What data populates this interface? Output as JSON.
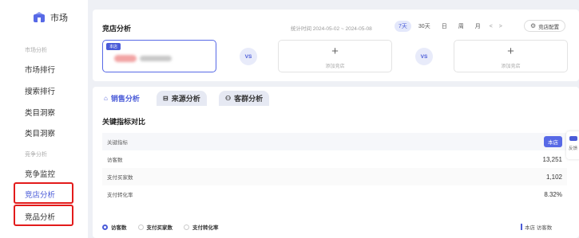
{
  "sidebar": {
    "brand": "市场",
    "sections": [
      {
        "label": "市场分析",
        "items": [
          "市场排行",
          "搜索排行",
          "类目洞察",
          "类目洞察"
        ]
      },
      {
        "label": "竞争分析",
        "items": [
          "竞争监控",
          "竞店分析",
          "竞品分析"
        ]
      }
    ],
    "active_item": "竞店分析"
  },
  "header": {
    "title": "竞店分析",
    "period": "统计时间 2024-05-02 ~ 2024-05-08",
    "ranges": [
      "7天",
      "30天",
      "日",
      "周",
      "月"
    ],
    "active_range": "7天",
    "prev": "<",
    "next": ">",
    "config_button": "竞店配置"
  },
  "compare": {
    "store_tag": "本店",
    "vs": "VS",
    "add_plus": "+",
    "add_label": "添加竞店"
  },
  "tabs": [
    {
      "label": "销售分析",
      "icon": "shop-icon"
    },
    {
      "label": "来源分析",
      "icon": "source-icon"
    },
    {
      "label": "客群分析",
      "icon": "users-icon"
    }
  ],
  "metrics": {
    "title": "关键指标对比",
    "header": "关键指标",
    "badge": "本店",
    "rows": [
      {
        "label": "访客数",
        "value": "13,251"
      },
      {
        "label": "支付买家数",
        "value": "1,102"
      },
      {
        "label": "支付转化率",
        "value": "8.32%"
      }
    ]
  },
  "legend": {
    "options": [
      "访客数",
      "支付买家数",
      "支付转化率"
    ],
    "selected": "访客数",
    "right_label": "本店 访客数"
  },
  "float_tab": {
    "label": "反馈"
  },
  "colors": {
    "accent": "#4a5bd8",
    "highlight_border": "#e31b1b"
  }
}
